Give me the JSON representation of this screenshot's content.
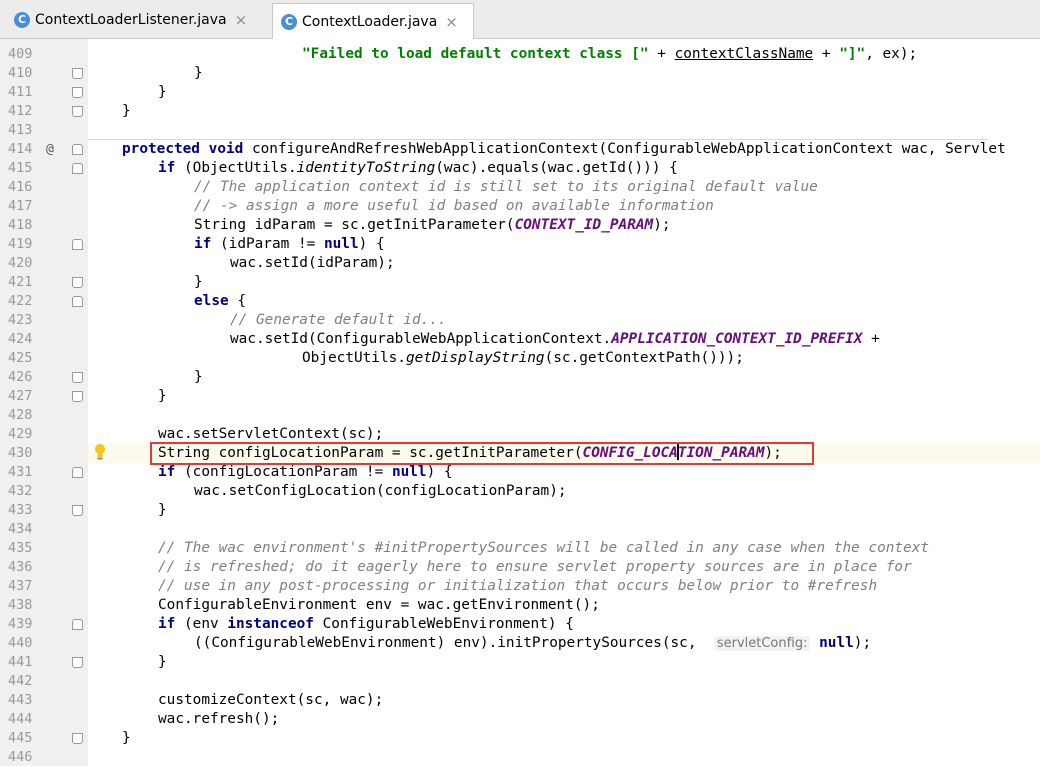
{
  "tabs": [
    {
      "label": "ContextLoaderListener.java",
      "icon": "C",
      "active": false
    },
    {
      "label": "ContextLoader.java",
      "icon": "C",
      "active": true
    }
  ],
  "lines": [
    {
      "n": "409",
      "code": "\"Failed to load default context class [\" + contextClassName + \"]\", ex);"
    },
    {
      "n": "410",
      "code": "}"
    },
    {
      "n": "411",
      "code": "}"
    },
    {
      "n": "412",
      "code": "}"
    },
    {
      "n": "413",
      "code": ""
    },
    {
      "n": "414",
      "code": "protected void configureAndRefreshWebApplicationContext(ConfigurableWebApplicationContext wac, Servlet"
    },
    {
      "n": "415",
      "code": "if (ObjectUtils.identityToString(wac).equals(wac.getId())) {"
    },
    {
      "n": "416",
      "code": "// The application context id is still set to its original default value"
    },
    {
      "n": "417",
      "code": "// -> assign a more useful id based on available information"
    },
    {
      "n": "418",
      "code": "String idParam = sc.getInitParameter(CONTEXT_ID_PARAM);"
    },
    {
      "n": "419",
      "code": "if (idParam != null) {"
    },
    {
      "n": "420",
      "code": "wac.setId(idParam);"
    },
    {
      "n": "421",
      "code": "}"
    },
    {
      "n": "422",
      "code": "else {"
    },
    {
      "n": "423",
      "code": "// Generate default id..."
    },
    {
      "n": "424",
      "code": "wac.setId(ConfigurableWebApplicationContext.APPLICATION_CONTEXT_ID_PREFIX +"
    },
    {
      "n": "425",
      "code": "ObjectUtils.getDisplayString(sc.getContextPath()));"
    },
    {
      "n": "426",
      "code": "}"
    },
    {
      "n": "427",
      "code": "}"
    },
    {
      "n": "428",
      "code": ""
    },
    {
      "n": "429",
      "code": "wac.setServletContext(sc);"
    },
    {
      "n": "430",
      "code": "String configLocationParam = sc.getInitParameter(CONFIG_LOCATION_PARAM);"
    },
    {
      "n": "431",
      "code": "if (configLocationParam != null) {"
    },
    {
      "n": "432",
      "code": "wac.setConfigLocation(configLocationParam);"
    },
    {
      "n": "433",
      "code": "}"
    },
    {
      "n": "434",
      "code": ""
    },
    {
      "n": "435",
      "code": "// The wac environment's #initPropertySources will be called in any case when the context"
    },
    {
      "n": "436",
      "code": "// is refreshed; do it eagerly here to ensure servlet property sources are in place for"
    },
    {
      "n": "437",
      "code": "// use in any post-processing or initialization that occurs below prior to #refresh"
    },
    {
      "n": "438",
      "code": "ConfigurableEnvironment env = wac.getEnvironment();"
    },
    {
      "n": "439",
      "code": "if (env instanceof ConfigurableWebEnvironment) {"
    },
    {
      "n": "440",
      "code": "((ConfigurableWebEnvironment) env).initPropertySources(sc,  servletConfig: null);"
    },
    {
      "n": "441",
      "code": "}"
    },
    {
      "n": "442",
      "code": ""
    },
    {
      "n": "443",
      "code": "customizeContext(sc, wac);"
    },
    {
      "n": "444",
      "code": "wac.refresh();"
    },
    {
      "n": "445",
      "code": "}"
    },
    {
      "n": "446",
      "code": ""
    }
  ],
  "param_hint": "servletConfig:",
  "override_marker": "@"
}
